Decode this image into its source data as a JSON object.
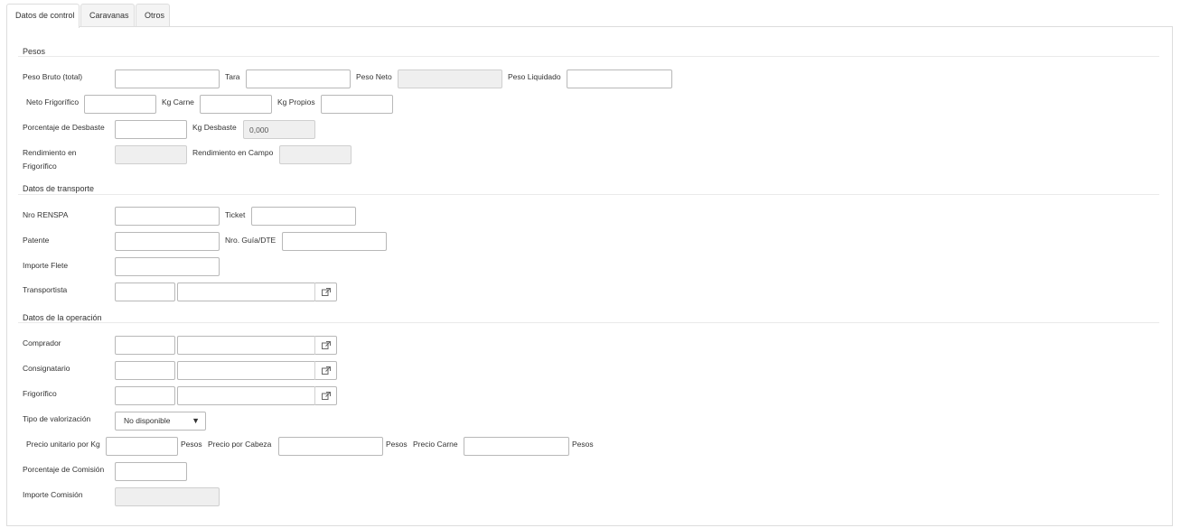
{
  "tabs": [
    "Datos de control",
    "Caravanas",
    "Otros"
  ],
  "sections": {
    "pesos": "Pesos",
    "transporte": "Datos de transporte",
    "operacion": "Datos de la operación"
  },
  "pesos": {
    "peso_bruto": "Peso Bruto (total)",
    "tara": "Tara",
    "peso_neto": "Peso Neto",
    "peso_liquidado": "Peso Liquidado",
    "neto_frigorifico": "Neto Frigorífico",
    "kg_carne": "Kg Carne",
    "kg_propios": "Kg Propios",
    "porcentaje_desbaste": "Porcentaje de Desbaste",
    "kg_desbaste": "Kg Desbaste",
    "kg_desbaste_value": "0,000",
    "rendimiento_frigorifico_l1": "Rendimiento en",
    "rendimiento_frigorifico_l2": "Frigorífico",
    "rendimiento_campo": "Rendimiento en Campo"
  },
  "transporte": {
    "nro_renspa": "Nro RENSPA",
    "ticket": "Ticket",
    "patente": "Patente",
    "nro_guia": "Nro. Guía/DTE",
    "importe_flete": "Importe Flete",
    "transportista": "Transportista"
  },
  "operacion": {
    "comprador": "Comprador",
    "consignatario": "Consignatario",
    "frigorifico": "Frigorífico",
    "tipo_valorizacion": "Tipo de valorización",
    "tipo_valorizacion_selected": "No disponible",
    "precio_unitario_kg": "Precio unitario por Kg",
    "pesos_unit": "Pesos",
    "precio_por_cabeza": "Precio por Cabeza",
    "precio_carne": "Precio Carne",
    "porcentaje_comision": "Porcentaje de Comisión",
    "importe_comision": "Importe Comisión"
  },
  "icons": {
    "lookup": "external-link-icon",
    "dropdown": "caret-down-icon"
  }
}
